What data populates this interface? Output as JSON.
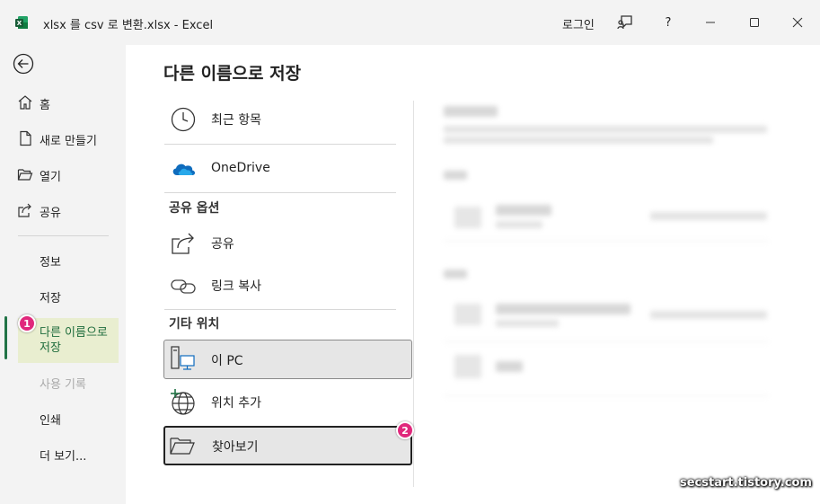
{
  "titlebar": {
    "title": "xlsx 를 csv 로 변환.xlsx  -  Excel",
    "login": "로그인",
    "help": "?"
  },
  "sidebar": {
    "items": [
      {
        "label": "홈",
        "icon": "home-icon"
      },
      {
        "label": "새로 만들기",
        "icon": "new-file-icon"
      },
      {
        "label": "열기",
        "icon": "folder-open-icon"
      },
      {
        "label": "공유",
        "icon": "share-icon"
      }
    ],
    "info": "정보",
    "save": "저장",
    "save_as": "다른 이름으로\n저장",
    "history": "사용 기록",
    "print": "인쇄",
    "more": "더 보기..."
  },
  "main": {
    "title": "다른 이름으로 저장",
    "recent": "최근 항목",
    "onedrive": "OneDrive",
    "share_options_heading": "공유 옵션",
    "share": "공유",
    "copy_link": "링크 복사",
    "other_locations_heading": "기타 위치",
    "this_pc": "이 PC",
    "add_location": "위치 추가",
    "browse": "찾아보기"
  },
  "badges": {
    "one": "1",
    "two": "2"
  },
  "watermark": "secstart.tistory.com",
  "colors": {
    "accent": "#217346",
    "badge": "#e0287c",
    "selected_bg": "#e9eed0"
  }
}
